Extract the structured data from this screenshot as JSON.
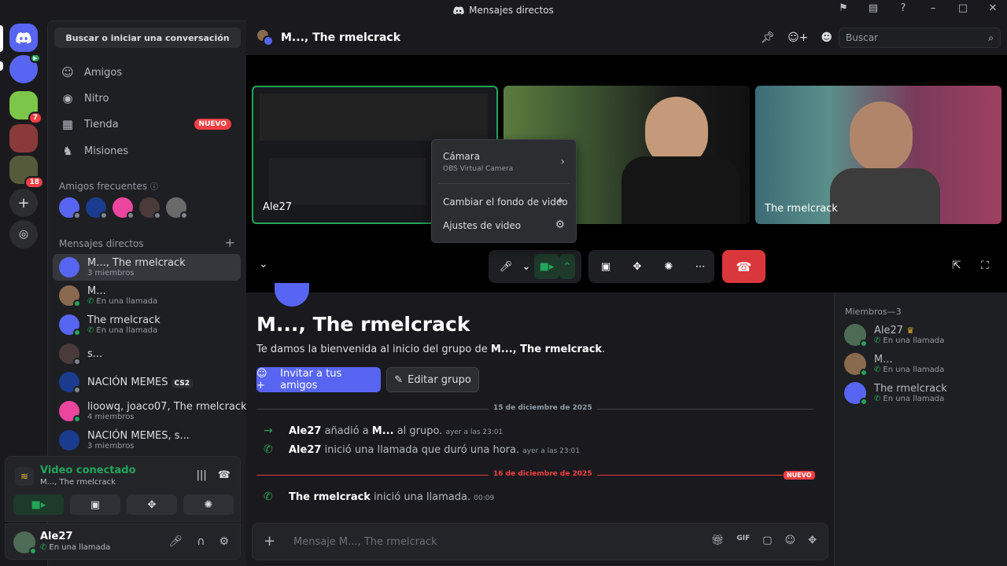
{
  "window": {
    "title": "Mensajes directos"
  },
  "sidebar": {
    "search_label": "Buscar o iniciar una conversación",
    "nav": [
      {
        "label": "Amigos",
        "icon": "friends-icon"
      },
      {
        "label": "Nitro",
        "icon": "nitro-icon"
      },
      {
        "label": "Tienda",
        "icon": "shop-icon",
        "badge": "NUEVO"
      },
      {
        "label": "Misiones",
        "icon": "quests-icon"
      }
    ],
    "frequent_label": "Amigos frecuentes",
    "dm_label": "Mensajes directos",
    "dms": [
      {
        "name": "M..., The rmelcrack",
        "sub": "3 miembros"
      },
      {
        "name": "M...",
        "sub": "En una llamada"
      },
      {
        "name": "The rmelcrack",
        "sub": "En una llamada"
      },
      {
        "name": "s...",
        "sub": ""
      },
      {
        "name": "NACIÓN MEMES",
        "sub": "",
        "tag": "CS2"
      },
      {
        "name": "lioowq, joaco07, The rmelcrack",
        "sub": "4 miembros"
      },
      {
        "name": "NACIÓN MEMES, s...",
        "sub": "3 miembros"
      }
    ],
    "server_badges": [
      "7",
      "18"
    ]
  },
  "voice": {
    "title": "Video conectado",
    "subtitle": "M..., The rmelcrack"
  },
  "user": {
    "name": "Ale27",
    "status": "En una llamada"
  },
  "header": {
    "title": "M..., The rmelcrack",
    "search_placeholder": "Buscar"
  },
  "call": {
    "tiles": [
      {
        "label": "Ale27"
      },
      {
        "label": ""
      },
      {
        "label": "The rmelcrack"
      }
    ],
    "menu": {
      "camera_label": "Cámara",
      "camera_device": "OBS Virtual Camera",
      "bg_label": "Cambiar el fondo de video",
      "settings_label": "Ajustes de video"
    }
  },
  "chat": {
    "title": "M..., The rmelcrack",
    "welcome_prefix": "Te damos la bienvenida al inicio del grupo de ",
    "welcome_group": "M..., The rmelcrack",
    "welcome_suffix": ".",
    "invite_label": "Invitar a tus amigos",
    "edit_label": "Editar grupo",
    "date1": "15 de diciembre de 2025",
    "date2": "16 de diciembre de 2025",
    "nuevo": "NUEVO",
    "messages": [
      {
        "actor": "Ale27",
        "text1": " añadió a ",
        "target": "M...",
        "text2": " al grupo.",
        "time": "ayer a las 23:01"
      },
      {
        "actor": "Ale27",
        "text1": " inició una llamada que duró una hora.",
        "target": "",
        "text2": "",
        "time": "ayer a las 23:01"
      },
      {
        "actor": "The rmelcrack",
        "text1": " inició una llamada.",
        "target": "",
        "text2": "",
        "time": "00:09"
      }
    ],
    "composer_placeholder": "Mensaje M..., The rmelcrack"
  },
  "members": {
    "title": "Miembros—3",
    "list": [
      {
        "name": "Ale27",
        "status": "En una llamada",
        "owner": true
      },
      {
        "name": "M...",
        "status": "En una llamada"
      },
      {
        "name": "The rmelcrack",
        "status": "En una llamada"
      }
    ]
  },
  "colors": {
    "blurple": "#5865f2",
    "green": "#23a55a",
    "red": "#da373c"
  }
}
